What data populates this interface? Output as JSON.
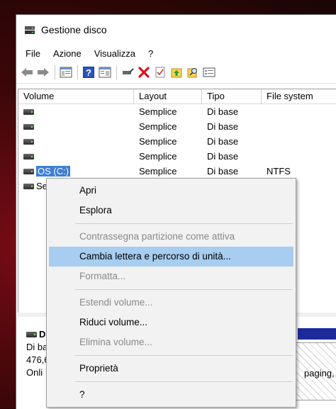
{
  "window": {
    "title": "Gestione disco",
    "icon": "disk-management-icon"
  },
  "menubar": [
    "File",
    "Azione",
    "Visualizza",
    "?"
  ],
  "toolbar": {
    "buttons": [
      {
        "name": "back-icon"
      },
      {
        "name": "forward-icon"
      },
      {
        "name": "console-tree-icon"
      },
      {
        "name": "help-icon"
      },
      {
        "name": "show-pane-icon"
      },
      {
        "name": "connect-disk-icon"
      },
      {
        "name": "delete-icon"
      },
      {
        "name": "check-icon"
      },
      {
        "name": "export-icon"
      },
      {
        "name": "search-icon"
      },
      {
        "name": "properties-icon"
      }
    ]
  },
  "volumes": {
    "columns": [
      "Volume",
      "Layout",
      "Tipo",
      "File system"
    ],
    "rows": [
      {
        "volume": "",
        "layout": "Semplice",
        "tipo": "Di base",
        "fs": ""
      },
      {
        "volume": "",
        "layout": "Semplice",
        "tipo": "Di base",
        "fs": ""
      },
      {
        "volume": "",
        "layout": "Semplice",
        "tipo": "Di base",
        "fs": ""
      },
      {
        "volume": "",
        "layout": "Semplice",
        "tipo": "Di base",
        "fs": ""
      },
      {
        "volume": "OS (C:)",
        "layout": "Semplice",
        "tipo": "Di base",
        "fs": "NTFS"
      },
      {
        "volume": "Se",
        "layout": "",
        "tipo": "",
        "fs": ""
      }
    ]
  },
  "disk": {
    "name": "D",
    "type": "Di ba",
    "size": "476,6",
    "status": "Onli",
    "partition_text": "paging,"
  },
  "context_menu": {
    "items": [
      {
        "label": "Apri",
        "enabled": true
      },
      {
        "label": "Esplora",
        "enabled": true
      },
      {
        "label": "Contrassegna partizione come attiva",
        "enabled": false
      },
      {
        "label": "Cambia lettera e percorso di unità...",
        "enabled": true,
        "highlighted": true
      },
      {
        "label": "Formatta...",
        "enabled": false
      },
      {
        "label": "Estendi volume...",
        "enabled": false
      },
      {
        "label": "Riduci volume...",
        "enabled": true
      },
      {
        "label": "Elimina volume...",
        "enabled": false
      },
      {
        "label": "Proprietà",
        "enabled": true
      },
      {
        "label": "?",
        "enabled": true
      }
    ]
  },
  "colors": {
    "selection": "#3d7fd6",
    "menu_highlight": "#a7cdf0",
    "partition_bar": "#1c2a9c",
    "background_red": "#7a0c14"
  }
}
